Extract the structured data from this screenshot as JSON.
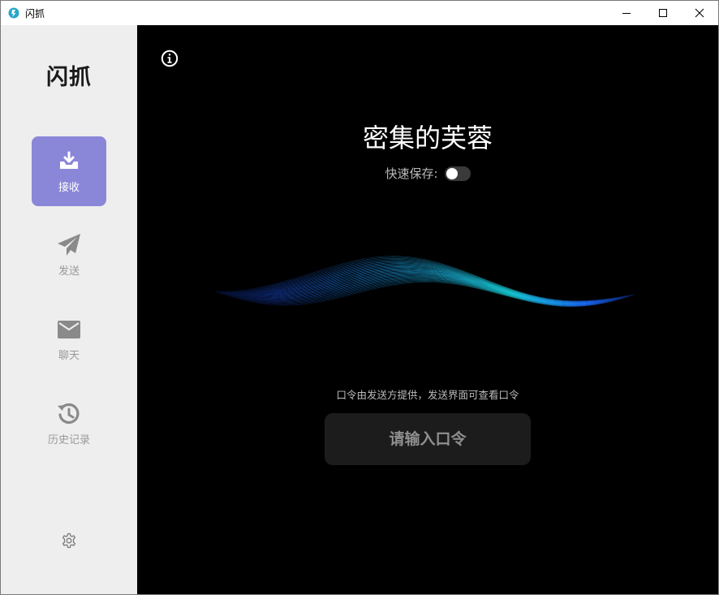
{
  "window": {
    "title": "闪抓"
  },
  "sidebar": {
    "brand": "闪抓",
    "items": [
      {
        "label": "接收",
        "icon": "download-tray-icon",
        "active": true
      },
      {
        "label": "发送",
        "icon": "paper-plane-icon",
        "active": false
      },
      {
        "label": "聊天",
        "icon": "envelope-icon",
        "active": false
      },
      {
        "label": "历史记录",
        "icon": "history-icon",
        "active": false
      }
    ],
    "settings_icon": "gear-icon"
  },
  "main": {
    "info_icon": "info-icon",
    "code_name": "密集的芙蓉",
    "quick_save_label": "快速保存:",
    "quick_save_enabled": false,
    "hint": "口令由发送方提供，发送界面可查看口令",
    "passcode_placeholder": "请输入口令",
    "passcode_value": ""
  },
  "colors": {
    "active_nav": "#8b87d8",
    "sidebar_bg": "#eeeeee",
    "main_bg": "#000000",
    "wave_blue": "#1a5cff",
    "wave_cyan": "#17d6e0"
  }
}
